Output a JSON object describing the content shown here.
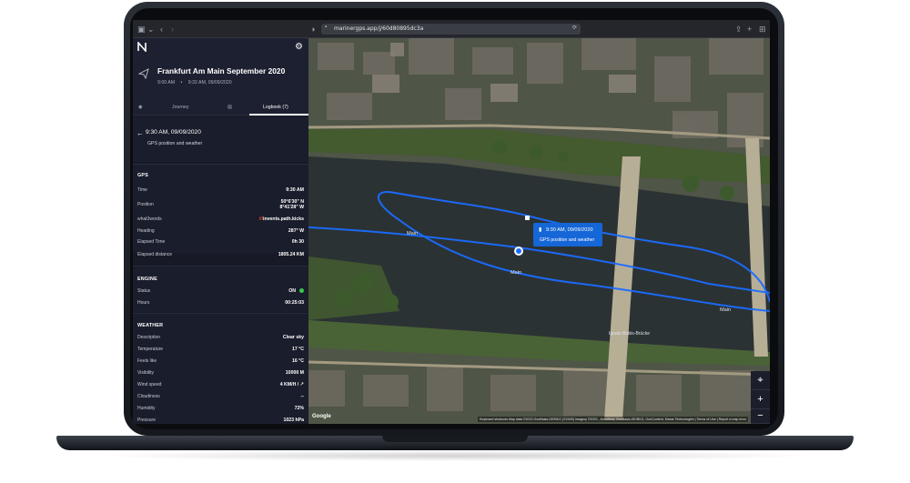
{
  "browser": {
    "url": "marinergps.app/j/60d80895dc3a"
  },
  "trip": {
    "title": "Frankfurt Am Main September 2020",
    "start": "9:00 AM",
    "separator": "•",
    "end": "9:32 AM, 09/09/2020"
  },
  "tabs": {
    "journey": "Journey",
    "logbook": "Logbook (7)"
  },
  "entry": {
    "time": "9:30 AM, 09/09/2020",
    "description": "GPS position and weather"
  },
  "gps": {
    "title": "GPS",
    "rows": [
      {
        "label": "Time",
        "value": "9:30 AM"
      },
      {
        "label": "Position",
        "value": "50°6'30\" N",
        "value2": "8°41'28\" W"
      },
      {
        "label": "what3words",
        "value": "invents.path.kicks",
        "prefix": "///"
      },
      {
        "label": "Heading",
        "value": "287° W"
      },
      {
        "label": "Elapsed Time",
        "value": "0h 30"
      },
      {
        "label": "Elapsed distance",
        "value": "1805.24 KM"
      }
    ]
  },
  "engine": {
    "title": "ENGINE",
    "rows": [
      {
        "label": "Status",
        "value": "ON"
      },
      {
        "label": "Hours",
        "value": "00:25:03"
      }
    ]
  },
  "weather": {
    "title": "WEATHER",
    "rows": [
      {
        "label": "Description",
        "value": "Clear sky"
      },
      {
        "label": "Temperature",
        "value": "17 °C"
      },
      {
        "label": "Feels like",
        "value": "16 °C"
      },
      {
        "label": "Visibility",
        "value": "10000 M"
      },
      {
        "label": "Wind speed",
        "value": "4 KM/H / ↗"
      },
      {
        "label": "Cloudiness",
        "value": "--"
      },
      {
        "label": "Humidity",
        "value": "72%"
      },
      {
        "label": "Pressure",
        "value": "1023 hPa"
      }
    ]
  },
  "map": {
    "popup_time": "9:30 AM, 09/09/2020",
    "popup_desc": "GPS position and weather",
    "river_label": "Main",
    "bridge_label": "Ignatz-Bubis-Brücke",
    "google": "Google",
    "attribution": "Keyboard shortcuts   Map data ©2023 GeoBasis-DE/BKG (©2009) Imagery ©2023 , AeroWest, GeoBasis-DE/BKG, GeoContent, Maxar Technologies | Terms of Use | Report a map error"
  },
  "colors": {
    "track": "#1a6dff",
    "sidebar": "#171a26",
    "popup": "#1566d6",
    "status_on": "#35c94a",
    "w3w": "#e0413a"
  }
}
